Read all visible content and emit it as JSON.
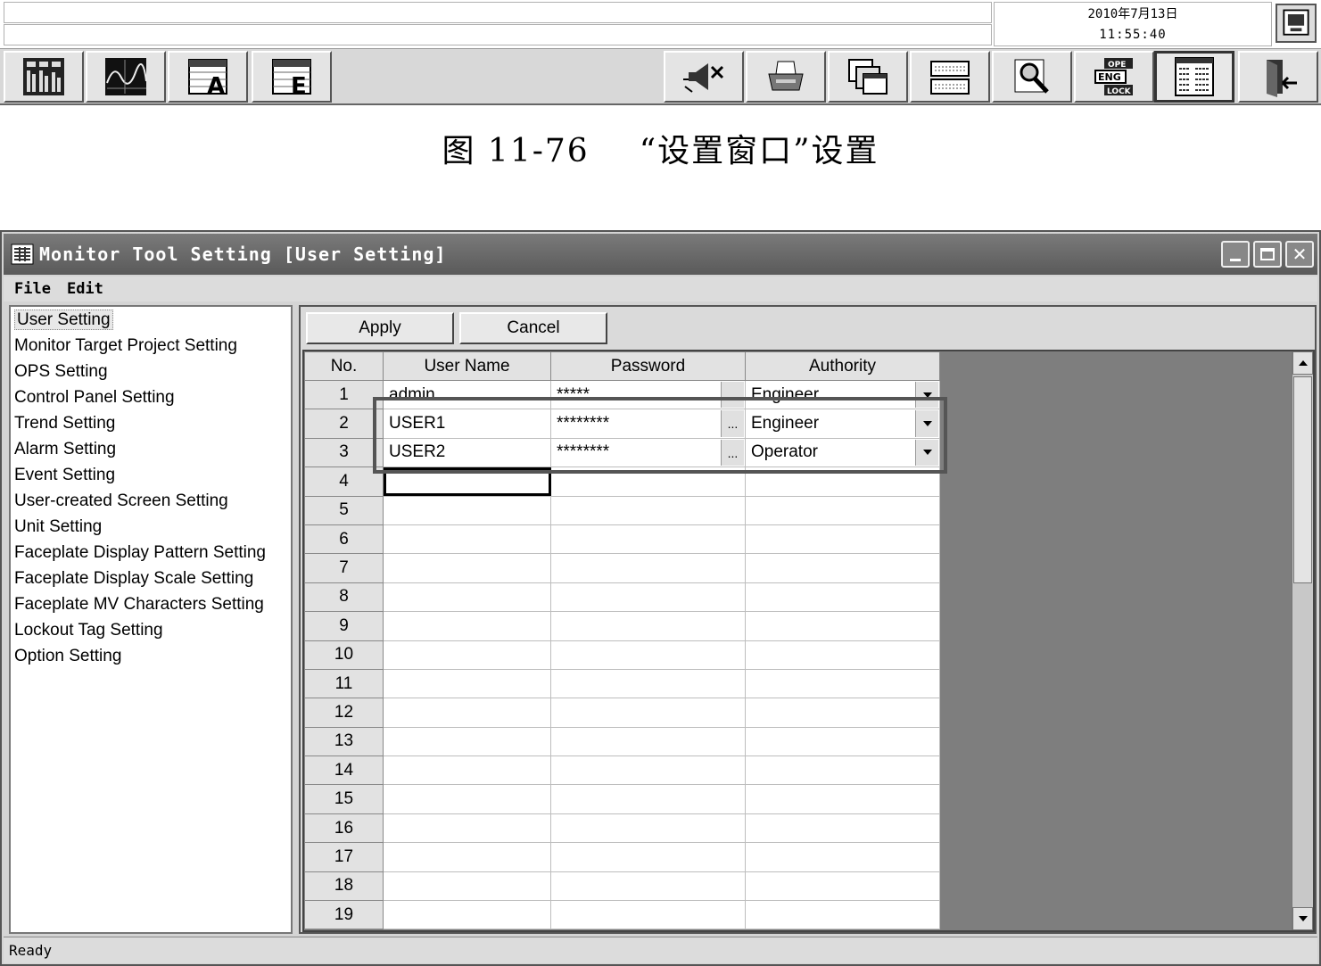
{
  "top_panel": {
    "date": "2010年7月13日",
    "time": "11:55:40",
    "toolbar_buttons": [
      {
        "icon": "faceplate-grid-icon"
      },
      {
        "icon": "trend-icon"
      },
      {
        "icon": "alarm-table-icon"
      },
      {
        "icon": "event-table-icon"
      },
      {
        "icon": "buzzer-stop-icon"
      },
      {
        "icon": "printer-icon"
      },
      {
        "icon": "window-switch-icon"
      },
      {
        "icon": "keyboard-icon"
      },
      {
        "icon": "search-icon"
      },
      {
        "icon": "ope-eng-lock-icon",
        "labels": [
          "OPE",
          "ENG",
          "LOCK"
        ]
      },
      {
        "icon": "setting-window-icon",
        "active": true
      },
      {
        "icon": "exit-icon"
      }
    ]
  },
  "caption": {
    "number": "图 11-76",
    "text": "“设置窗口”设置"
  },
  "window": {
    "title": "Monitor Tool Setting [User Setting]",
    "menu": [
      "File",
      "Edit"
    ],
    "tree_items": [
      "User Setting",
      "Monitor Target Project Setting",
      "OPS Setting",
      "Control Panel Setting",
      "Trend Setting",
      "Alarm Setting",
      "Event Setting",
      "User-created Screen Setting",
      "Unit Setting",
      "Faceplate Display Pattern Setting",
      "Faceplate Display Scale Setting",
      "Faceplate MV Characters Setting",
      "Lockout Tag Setting",
      "Option Setting"
    ],
    "selected_tree_item": "User Setting",
    "buttons": {
      "apply": "Apply",
      "cancel": "Cancel"
    },
    "grid": {
      "columns": [
        "No.",
        "User Name",
        "Password",
        "Authority"
      ],
      "rows": [
        {
          "no": "1",
          "user": "admin",
          "password": "*****",
          "authority": "Engineer"
        },
        {
          "no": "2",
          "user": "USER1",
          "password": "********",
          "authority": "Engineer"
        },
        {
          "no": "3",
          "user": "USER2",
          "password": "********",
          "authority": "Operator"
        },
        {
          "no": "4",
          "user": "",
          "password": "",
          "authority": ""
        },
        {
          "no": "5",
          "user": "",
          "password": "",
          "authority": ""
        },
        {
          "no": "6",
          "user": "",
          "password": "",
          "authority": ""
        },
        {
          "no": "7",
          "user": "",
          "password": "",
          "authority": ""
        },
        {
          "no": "8",
          "user": "",
          "password": "",
          "authority": ""
        },
        {
          "no": "9",
          "user": "",
          "password": "",
          "authority": ""
        },
        {
          "no": "10",
          "user": "",
          "password": "",
          "authority": ""
        },
        {
          "no": "11",
          "user": "",
          "password": "",
          "authority": ""
        },
        {
          "no": "12",
          "user": "",
          "password": "",
          "authority": ""
        },
        {
          "no": "13",
          "user": "",
          "password": "",
          "authority": ""
        },
        {
          "no": "14",
          "user": "",
          "password": "",
          "authority": ""
        },
        {
          "no": "15",
          "user": "",
          "password": "",
          "authority": ""
        },
        {
          "no": "16",
          "user": "",
          "password": "",
          "authority": ""
        },
        {
          "no": "17",
          "user": "",
          "password": "",
          "authority": ""
        },
        {
          "no": "18",
          "user": "",
          "password": "",
          "authority": ""
        },
        {
          "no": "19",
          "user": "",
          "password": "",
          "authority": ""
        }
      ],
      "ellipsis": "..."
    },
    "status": "Ready"
  }
}
